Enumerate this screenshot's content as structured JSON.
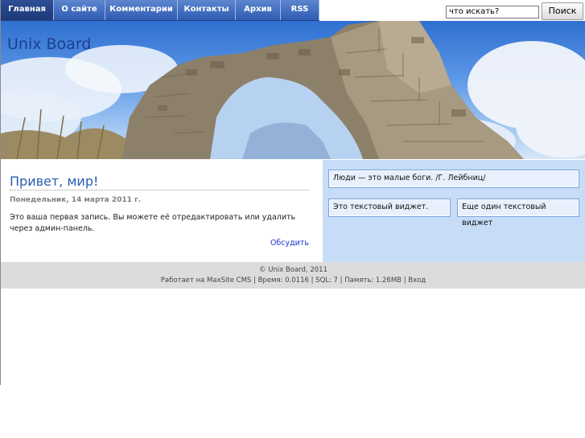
{
  "nav": {
    "items": [
      {
        "label": "Главная",
        "active": true
      },
      {
        "label": "О сайте",
        "active": false
      },
      {
        "label": "Комментарии",
        "active": false
      },
      {
        "label": "Контакты",
        "active": false
      },
      {
        "label": "Архив",
        "active": false
      },
      {
        "label": "RSS",
        "active": false
      }
    ]
  },
  "search": {
    "value": "что искать?",
    "button": "Поиск"
  },
  "header": {
    "title": "Unix Board"
  },
  "post": {
    "title": "Привет, мир!",
    "date": "Понедельник, 14 марта 2011 г.",
    "text": "Это ваша первая запись. Вы можете её отредактировать или удалить через админ-панель.",
    "comment_link": "Обсудить"
  },
  "sidebar": {
    "quote": "Люди — это малые боги. /Г. Лейбниц/",
    "widget1": "Это текстовый виджет.",
    "widget2": "Еще один текстовый виджет"
  },
  "footer": {
    "copyright": "© Unix Board, 2011",
    "meta_prefix": "Работает на",
    "meta_link": "MaxSite CMS",
    "time": "Время: 0.0116",
    "sql": "SQL: 7",
    "memory": "Память: 1.26MB",
    "login": "Вход"
  },
  "colors": {
    "menu": "#2f5cb2",
    "title": "#2a5cb0",
    "sidebar": "#c7dcf7",
    "footer": "#dcdcdc",
    "link": "#1a35c7"
  }
}
